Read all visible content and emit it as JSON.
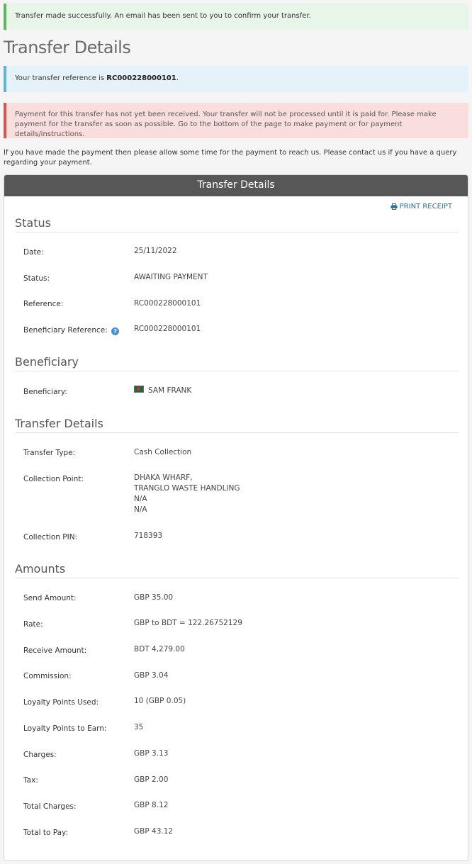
{
  "alerts": {
    "success": "Transfer made successfully. An email has been sent to you to confirm your transfer.",
    "info_prefix": "Your transfer reference is ",
    "info_reference": "RC000228000101",
    "info_suffix": ".",
    "danger": "Payment for this transfer has not yet been received. Your transfer will not be processed until it is paid for. Please make payment for the transfer as soon as possible. Go to the bottom of the page to make payment or for payment details/instructions."
  },
  "page_title": "Transfer Details",
  "info_text": "If you have made the payment then please allow some time for the payment to reach us. Please contact us if you have a query regarding your payment.",
  "panel": {
    "header": "Transfer Details",
    "print_label": "PRINT RECEIPT",
    "print_icon": "printer-icon"
  },
  "status": {
    "title": "Status",
    "date_label": "Date:",
    "date_value": "25/11/2022",
    "status_label": "Status:",
    "status_value": "AWAITING PAYMENT",
    "reference_label": "Reference:",
    "reference_value": "RC000228000101",
    "beneficiary_reference_label": "Beneficiary Reference:",
    "beneficiary_reference_value": "RC000228000101",
    "help_icon": "question-icon"
  },
  "beneficiary": {
    "title": "Beneficiary",
    "label": "Beneficiary:",
    "value": "SAM FRANK",
    "flag_icon": "bangladesh-flag-icon"
  },
  "transfer_details": {
    "title": "Transfer Details",
    "type_label": "Transfer Type:",
    "type_value": "Cash Collection",
    "collection_point_label": "Collection Point:",
    "collection_point_lines": [
      "DHAKA WHARF,",
      "TRANGLO WASTE HANDLING",
      "N/A",
      "N/A"
    ],
    "pin_label": "Collection PIN:",
    "pin_value": "718393"
  },
  "amounts": {
    "title": "Amounts",
    "rows": [
      {
        "label": "Send Amount:",
        "value": "GBP 35.00"
      },
      {
        "label": "Rate:",
        "value": "GBP to BDT = 122.26752129"
      },
      {
        "label": "Receive Amount:",
        "value": "BDT 4,279.00"
      },
      {
        "label": "Commission:",
        "value": "GBP 3.04"
      },
      {
        "label": "Loyalty Points Used:",
        "value": "10 (GBP 0.05)"
      },
      {
        "label": "Loyalty Points to Earn:",
        "value": "35"
      },
      {
        "label": "Charges:",
        "value": "GBP 3.13"
      },
      {
        "label": "Tax:",
        "value": "GBP 2.00"
      },
      {
        "label": "Total Charges:",
        "value": "GBP 8.12"
      },
      {
        "label": "Total to Pay:",
        "value": "GBP 43.12"
      }
    ]
  },
  "colors": {
    "success_border": "#5cb85c",
    "info_border": "#5bb5dd",
    "danger_border": "#d9534f",
    "panel_header": "#575757",
    "link": "#2a6f97"
  }
}
